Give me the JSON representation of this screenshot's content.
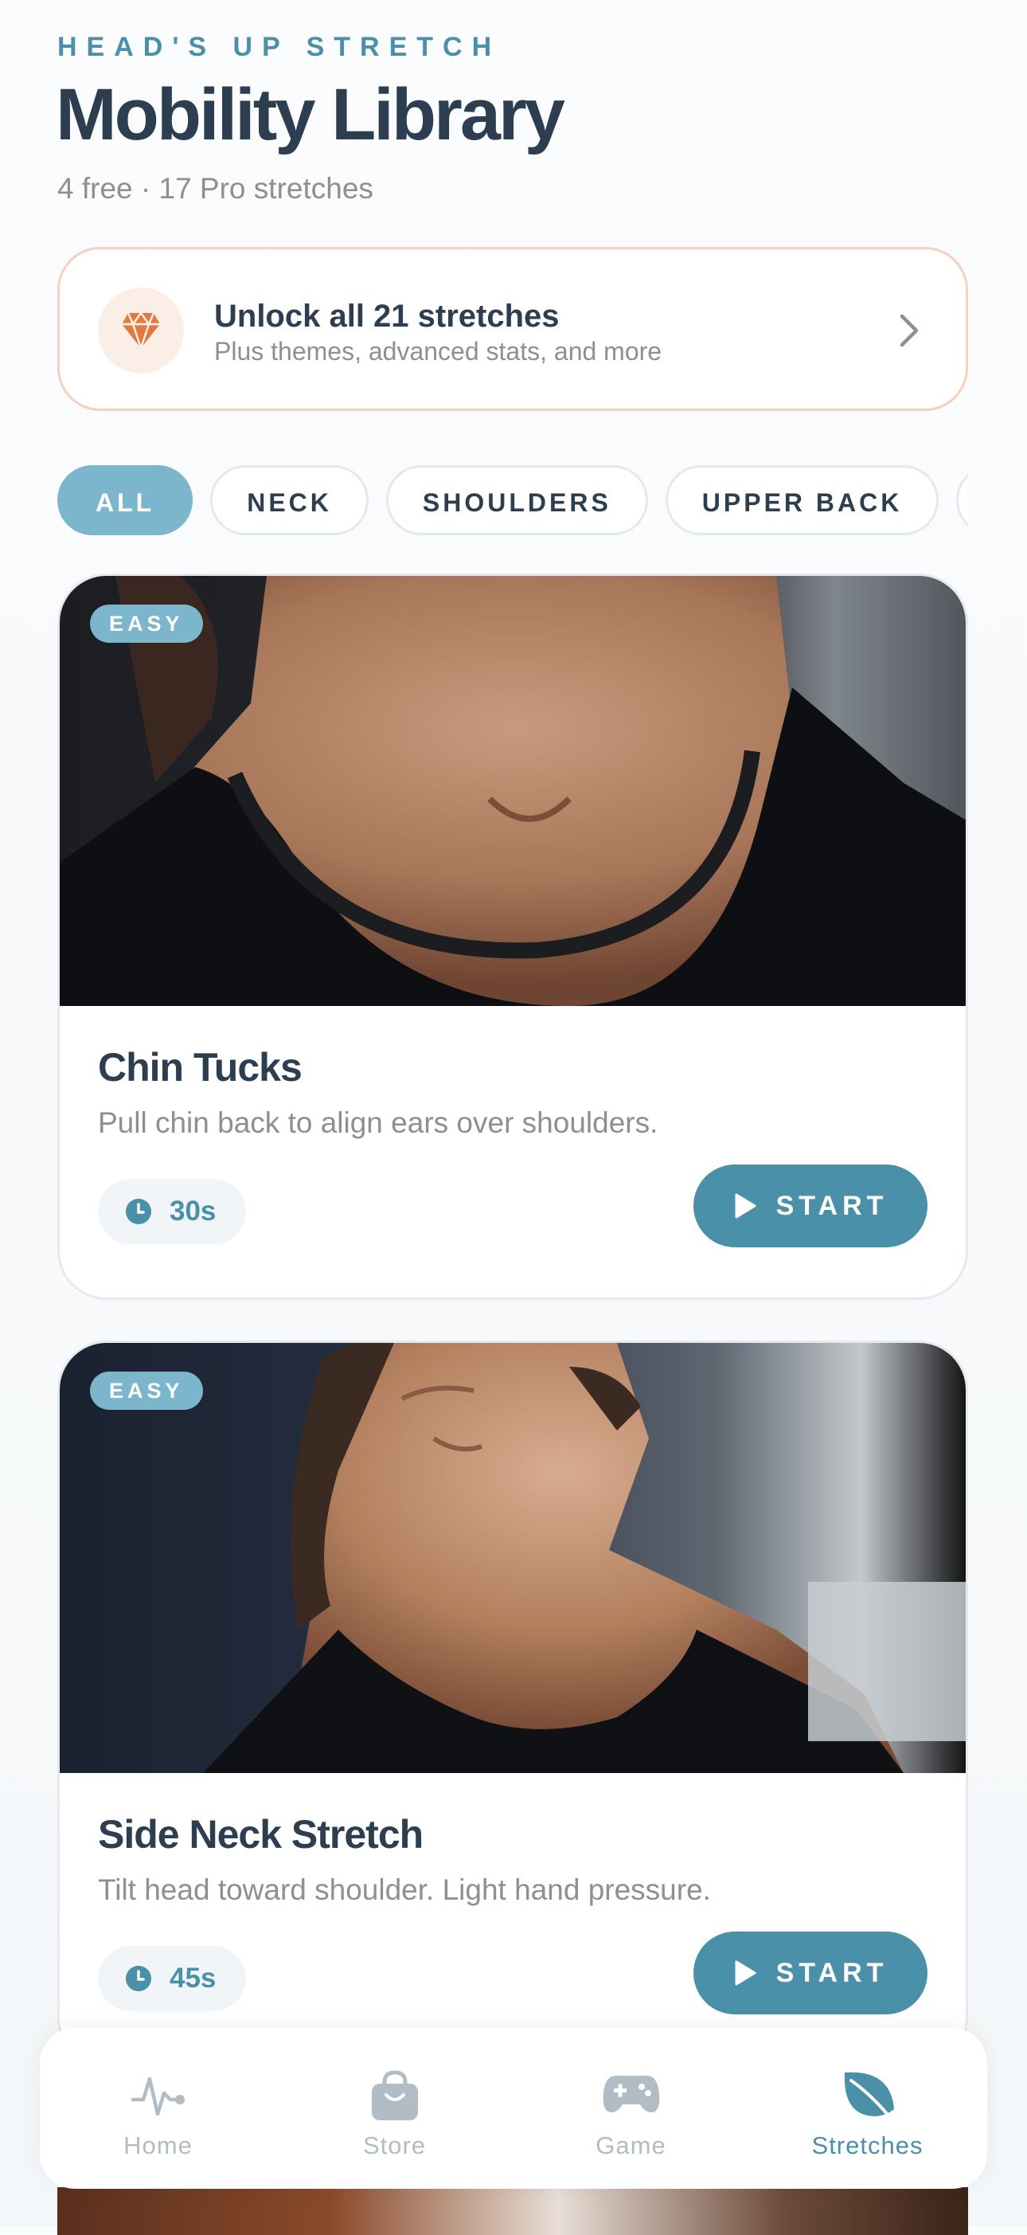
{
  "header": {
    "eyebrow": "HEAD'S UP STRETCH",
    "title": "Mobility Library",
    "subtitle": "4 free · 17 Pro stretches"
  },
  "promo": {
    "icon": "diamond-icon",
    "title": "Unlock all 21 stretches",
    "subtitle": "Plus themes, advanced stats, and more",
    "accent": "#e07a3f"
  },
  "filters": {
    "items": [
      {
        "label": "ALL",
        "active": true
      },
      {
        "label": "NECK"
      },
      {
        "label": "SHOULDERS"
      },
      {
        "label": "UPPER BACK"
      },
      {
        "label": ""
      }
    ]
  },
  "stretches": [
    {
      "badge": "EASY",
      "title": "Chin Tucks",
      "description": "Pull chin back to align ears over shoulders.",
      "duration": "30s",
      "start_label": "START"
    },
    {
      "badge": "EASY",
      "title": "Side Neck Stretch",
      "description": "Tilt head toward shoulder. Light hand pressure.",
      "duration": "45s",
      "start_label": "START"
    }
  ],
  "tabbar": {
    "items": [
      {
        "label": "Home",
        "icon": "activity-icon"
      },
      {
        "label": "Store",
        "icon": "shopping-bag-icon"
      },
      {
        "label": "Game",
        "icon": "gamepad-icon"
      },
      {
        "label": "Stretches",
        "icon": "leaf-icon",
        "active": true
      }
    ]
  },
  "colors": {
    "primary": "#4a90a8",
    "chip_active": "#7bb6cc",
    "text": "#2c3e50",
    "muted": "#8e8e93"
  }
}
